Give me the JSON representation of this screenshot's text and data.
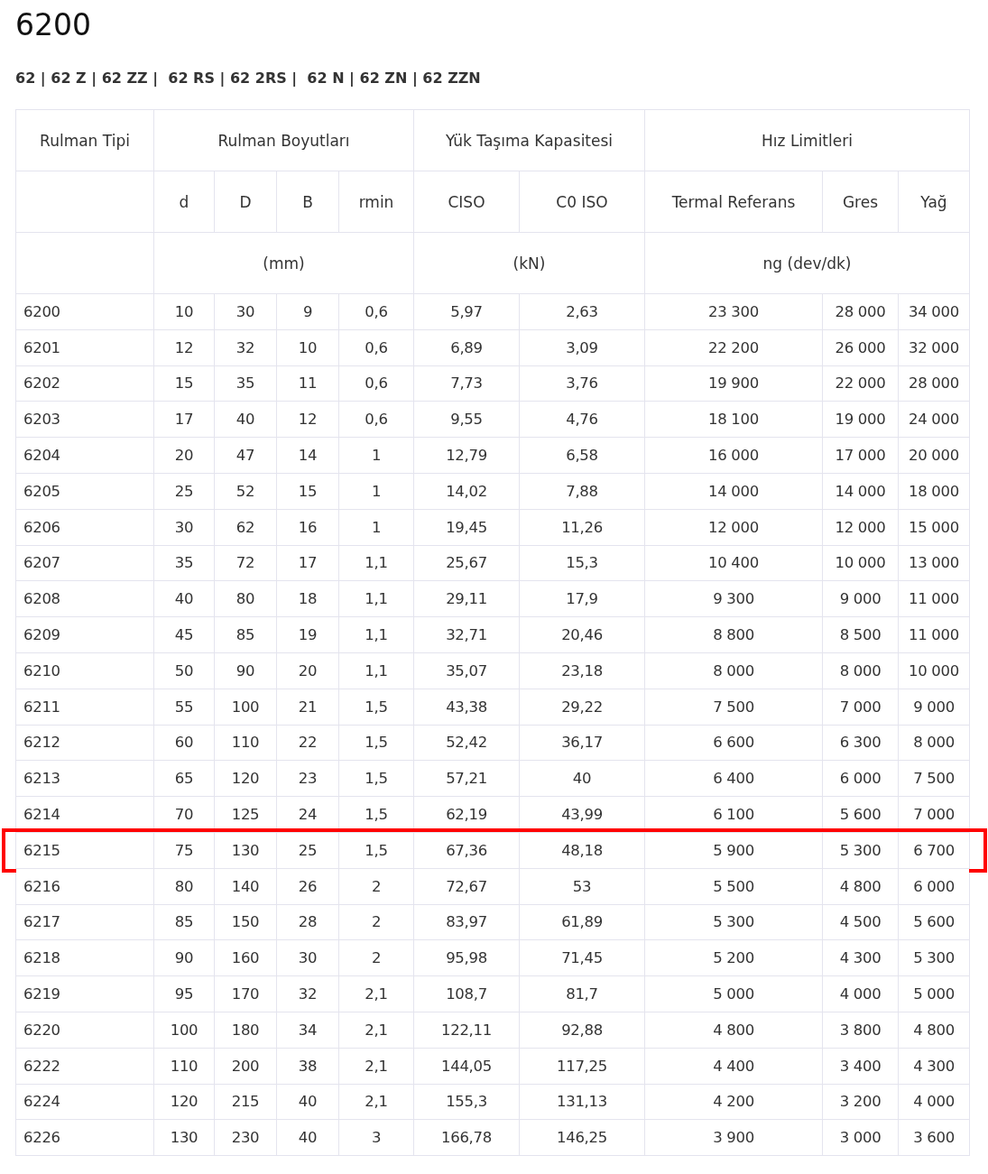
{
  "title": "6200",
  "variants": "62 | 62 Z | 62 ZZ |  62 RS | 62 2RS |  62 N | 62 ZN | 62 ZZN",
  "table": {
    "group_headers": [
      "Rulman Tipi",
      "Rulman Boyutları",
      "Yük Taşıma Kapasitesi",
      "Hız Limitleri"
    ],
    "columns": [
      "",
      "d",
      "D",
      "B",
      "rmin",
      "CISO",
      "C0 ISO",
      "Termal Referans",
      "Gres",
      "Yağ"
    ],
    "units": [
      "(mm)",
      "(kN)",
      "ng (dev/dk)"
    ],
    "rows": [
      {
        "cells": [
          "6200",
          "10",
          "30",
          "9",
          "0,6",
          "5,97",
          "2,63",
          "23 300",
          "28 000",
          "34 000"
        ],
        "highlighted": false
      },
      {
        "cells": [
          "6201",
          "12",
          "32",
          "10",
          "0,6",
          "6,89",
          "3,09",
          "22 200",
          "26 000",
          "32 000"
        ],
        "highlighted": false
      },
      {
        "cells": [
          "6202",
          "15",
          "35",
          "11",
          "0,6",
          "7,73",
          "3,76",
          "19 900",
          "22 000",
          "28 000"
        ],
        "highlighted": false
      },
      {
        "cells": [
          "6203",
          "17",
          "40",
          "12",
          "0,6",
          "9,55",
          "4,76",
          "18 100",
          "19 000",
          "24 000"
        ],
        "highlighted": false
      },
      {
        "cells": [
          "6204",
          "20",
          "47",
          "14",
          "1",
          "12,79",
          "6,58",
          "16 000",
          "17 000",
          "20 000"
        ],
        "highlighted": false
      },
      {
        "cells": [
          "6205",
          "25",
          "52",
          "15",
          "1",
          "14,02",
          "7,88",
          "14 000",
          "14 000",
          "18 000"
        ],
        "highlighted": false
      },
      {
        "cells": [
          "6206",
          "30",
          "62",
          "16",
          "1",
          "19,45",
          "11,26",
          "12 000",
          "12 000",
          "15 000"
        ],
        "highlighted": false
      },
      {
        "cells": [
          "6207",
          "35",
          "72",
          "17",
          "1,1",
          "25,67",
          "15,3",
          "10 400",
          "10 000",
          "13 000"
        ],
        "highlighted": false
      },
      {
        "cells": [
          "6208",
          "40",
          "80",
          "18",
          "1,1",
          "29,11",
          "17,9",
          "9 300",
          "9 000",
          "11 000"
        ],
        "highlighted": false
      },
      {
        "cells": [
          "6209",
          "45",
          "85",
          "19",
          "1,1",
          "32,71",
          "20,46",
          "8 800",
          "8 500",
          "11 000"
        ],
        "highlighted": false
      },
      {
        "cells": [
          "6210",
          "50",
          "90",
          "20",
          "1,1",
          "35,07",
          "23,18",
          "8 000",
          "8 000",
          "10 000"
        ],
        "highlighted": false
      },
      {
        "cells": [
          "6211",
          "55",
          "100",
          "21",
          "1,5",
          "43,38",
          "29,22",
          "7 500",
          "7 000",
          "9 000"
        ],
        "highlighted": false
      },
      {
        "cells": [
          "6212",
          "60",
          "110",
          "22",
          "1,5",
          "52,42",
          "36,17",
          "6 600",
          "6 300",
          "8 000"
        ],
        "highlighted": false
      },
      {
        "cells": [
          "6213",
          "65",
          "120",
          "23",
          "1,5",
          "57,21",
          "40",
          "6 400",
          "6 000",
          "7 500"
        ],
        "highlighted": false
      },
      {
        "cells": [
          "6214",
          "70",
          "125",
          "24",
          "1,5",
          "62,19",
          "43,99",
          "6 100",
          "5 600",
          "7 000"
        ],
        "highlighted": false
      },
      {
        "cells": [
          "6215",
          "75",
          "130",
          "25",
          "1,5",
          "67,36",
          "48,18",
          "5 900",
          "5 300",
          "6 700"
        ],
        "highlighted": true
      },
      {
        "cells": [
          "6216",
          "80",
          "140",
          "26",
          "2",
          "72,67",
          "53",
          "5 500",
          "4 800",
          "6 000"
        ],
        "highlighted": false
      },
      {
        "cells": [
          "6217",
          "85",
          "150",
          "28",
          "2",
          "83,97",
          "61,89",
          "5 300",
          "4 500",
          "5 600"
        ],
        "highlighted": false
      },
      {
        "cells": [
          "6218",
          "90",
          "160",
          "30",
          "2",
          "95,98",
          "71,45",
          "5 200",
          "4 300",
          "5 300"
        ],
        "highlighted": false
      },
      {
        "cells": [
          "6219",
          "95",
          "170",
          "32",
          "2,1",
          "108,7",
          "81,7",
          "5 000",
          "4 000",
          "5 000"
        ],
        "highlighted": false
      },
      {
        "cells": [
          "6220",
          "100",
          "180",
          "34",
          "2,1",
          "122,11",
          "92,88",
          "4 800",
          "3 800",
          "4 800"
        ],
        "highlighted": false
      },
      {
        "cells": [
          "6222",
          "110",
          "200",
          "38",
          "2,1",
          "144,05",
          "117,25",
          "4 400",
          "3 400",
          "4 300"
        ],
        "highlighted": false
      },
      {
        "cells": [
          "6224",
          "120",
          "215",
          "40",
          "2,1",
          "155,3",
          "131,13",
          "4 200",
          "3 200",
          "4 000"
        ],
        "highlighted": false
      },
      {
        "cells": [
          "6226",
          "130",
          "230",
          "40",
          "3",
          "166,78",
          "146,25",
          "3 900",
          "3 000",
          "3 600"
        ],
        "highlighted": false
      }
    ]
  }
}
